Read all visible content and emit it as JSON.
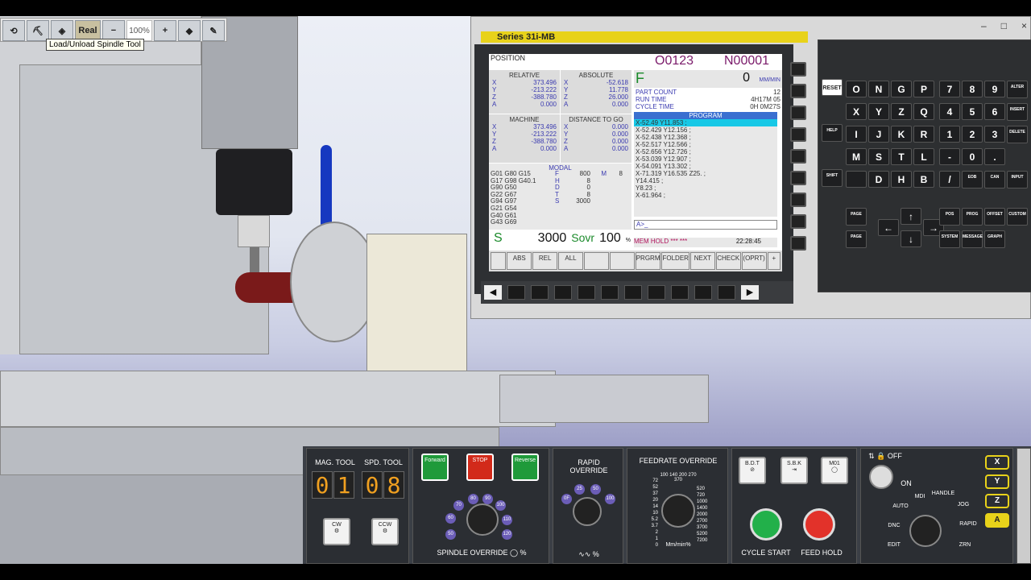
{
  "toolbar": {
    "real_label": "Real",
    "minus_label": "−",
    "zoom": "100%",
    "plus_label": "+"
  },
  "tooltip": "Load/Unload Spindle Tool",
  "cnc": {
    "series_label": "Series   31i-MB",
    "window_buttons": [
      "–",
      "□",
      "×"
    ],
    "position_label": "POSITION",
    "program_no": "O0123",
    "seq_no": "N00001",
    "relative": {
      "title": "RELATIVE",
      "axes": [
        "X",
        "Y",
        "Z",
        "A"
      ],
      "values": [
        "373.496",
        "-213.222",
        "-388.780",
        "0.000"
      ]
    },
    "absolute": {
      "title": "ABSOLUTE",
      "axes": [
        "X",
        "Y",
        "Z",
        "A"
      ],
      "values": [
        "-52.618",
        "11.778",
        "26.000",
        "0.000"
      ]
    },
    "machine": {
      "title": "MACHINE",
      "axes": [
        "X",
        "Y",
        "Z",
        "A"
      ],
      "values": [
        "373.496",
        "-213.222",
        "-388.780",
        "0.000"
      ]
    },
    "dist_to_go": {
      "title": "DISTANCE TO GO",
      "axes": [
        "X",
        "Y",
        "Z",
        "A"
      ],
      "values": [
        "0.000",
        "0.000",
        "0.000",
        "0.000"
      ]
    },
    "feed": {
      "label": "F",
      "value": "0",
      "unit": "MM/MIN"
    },
    "part_count_label": "PART COUNT",
    "part_count": "12",
    "run_time_label": "RUN TIME",
    "run_time": "4H17M 05",
    "cycle_time_label": "CYCLE TIME",
    "cycle_time": "0H 0M27S",
    "program_title": "PROGRAM",
    "program_lines": [
      "X-52.49 Y11.853 ;",
      "X-52.429 Y12.156 ;",
      "X-52.438 Y12.368 ;",
      "X-52.517 Y12.566 ;",
      "X-52.656 Y12.726 ;",
      "X-53.039 Y12.907 ;",
      "X-54.091 Y13.302 ;",
      "X-71.319 Y16.535 Z25. ;",
      "Y14.415 ;",
      "Y8.23 ;",
      "X-61.964 ;"
    ],
    "input_prompt": "A>_",
    "modal_title": "MODAL",
    "modal_codes": [
      "G01 G80 G15",
      "G17 G98 G40.1",
      "G90 G50",
      "G22 G67",
      "G94 G97",
      "G21 G54",
      "G40 G61",
      "G43 G69"
    ],
    "modal_values": [
      {
        "k": "F",
        "v": "800",
        "u": "M",
        "n": "8"
      },
      {
        "k": "H",
        "v": "8"
      },
      {
        "k": "D",
        "v": "0"
      },
      {
        "k": "T",
        "v": "8"
      },
      {
        "k": "S",
        "v": "3000"
      }
    ],
    "spindle": {
      "label": "S",
      "value": "3000",
      "ovr_label": "Sovr",
      "ovr_value": "100",
      "pct": "%"
    },
    "status_line": "MEM HOLD ***  ***",
    "time": "22:28:45",
    "softkeys": [
      "ABS",
      "REL",
      "ALL",
      "",
      "",
      "PRGRM",
      "FOLDER",
      "NEXT",
      "CHECK",
      "(OPRT)",
      "+"
    ]
  },
  "keypad": {
    "reset": "RESET",
    "help": "HELP",
    "shift": "SHIFT",
    "rows": [
      [
        "O",
        "N",
        "G",
        "P",
        "7",
        "8",
        "9",
        "ALTER"
      ],
      [
        "X",
        "Y",
        "Z",
        "Q",
        "4",
        "5",
        "6",
        "INSERT"
      ],
      [
        "I",
        "J",
        "K",
        "R",
        "1",
        "2",
        "3",
        "DELETE"
      ],
      [
        "M",
        "S",
        "T",
        "L",
        "-",
        "0",
        "."
      ],
      [
        "",
        "D",
        "H",
        "B",
        "/",
        "EOB",
        "CAN",
        "INPUT"
      ]
    ],
    "page_up": "PAGE",
    "page_down": "PAGE",
    "func_keys": [
      "POS",
      "PROG",
      "OFFSET",
      "CUSTOM",
      "SYSTEM",
      "MESSAGE",
      "GRAPH"
    ]
  },
  "panel": {
    "mag_tool_label": "MAG. TOOL",
    "spd_tool_label": "SPD. TOOL",
    "mag_digits": [
      "0",
      "1"
    ],
    "spd_digits": [
      "0",
      "8"
    ],
    "cw": "CW",
    "ccw": "CCW",
    "forward": "Forward",
    "stop": "STOP",
    "reverse": "Reverse",
    "spindle_override_label": "SPINDLE OVERRIDE",
    "spindle_override_unit": "%",
    "spindle_scale": [
      "50",
      "60",
      "70",
      "80",
      "90",
      "100",
      "110",
      "120"
    ],
    "rapid_label": "RAPID OVERRIDE",
    "rapid_scale": [
      "0F",
      "25",
      "50",
      "100"
    ],
    "rapid_unit": "%",
    "feedrate_label": "FEEDRATE OVERRIDE",
    "feed_scale": [
      "0",
      "1",
      "2",
      "3.7",
      "5.2",
      "10",
      "14",
      "20",
      "37",
      "52",
      "72",
      "100",
      "140",
      "200",
      "270",
      "370",
      "520",
      "720",
      "1000",
      "1400",
      "2000",
      "2700",
      "3700",
      "5200",
      "7200"
    ],
    "feed_units": "Mm/min%",
    "bdt": "B.D.T",
    "sbk": "S.B.K",
    "m01": "M01",
    "cycle_start": "CYCLE START",
    "feed_hold": "FEED HOLD",
    "off": "OFF",
    "on": "ON",
    "modes": [
      "AUTO",
      "MDI",
      "HANDLE",
      "JOG",
      "RAPID",
      "ZRN",
      "DNC",
      "EDIT"
    ],
    "axes": [
      "X",
      "Y",
      "Z",
      "A"
    ]
  }
}
